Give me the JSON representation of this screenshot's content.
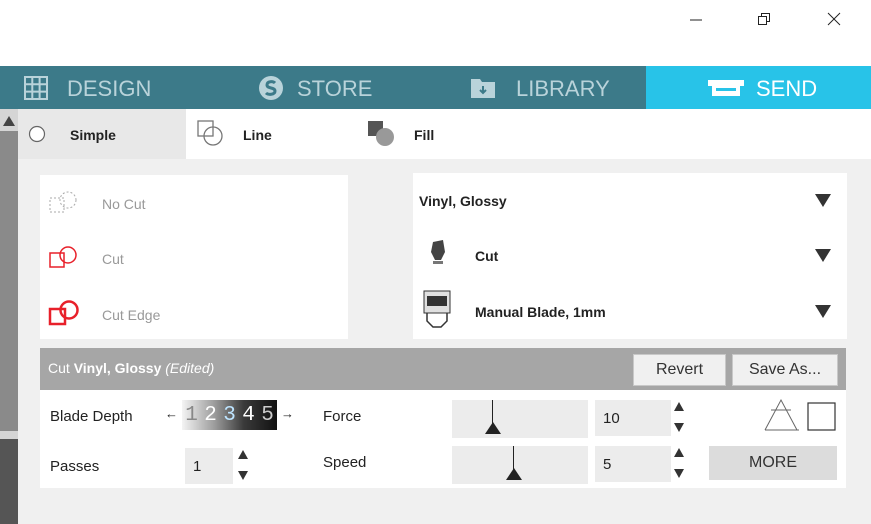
{
  "window": {
    "minimize_icon": "minimize-icon",
    "restore_icon": "restore-icon",
    "close_icon": "close-icon"
  },
  "tabs": [
    {
      "label": "DESIGN",
      "icon": "grid-icon"
    },
    {
      "label": "STORE",
      "icon": "store-s-icon"
    },
    {
      "label": "LIBRARY",
      "icon": "library-folder-icon"
    },
    {
      "label": "SEND",
      "icon": "cutter-icon",
      "active": true
    }
  ],
  "modes": [
    {
      "label": "Simple",
      "icon": "radio-icon"
    },
    {
      "label": "Line",
      "icon": "line-shapes-icon"
    },
    {
      "label": "Fill",
      "icon": "fill-shapes-icon"
    }
  ],
  "cut_options": [
    {
      "label": "No Cut",
      "icon": "no-cut-icon"
    },
    {
      "label": "Cut",
      "icon": "cut-icon"
    },
    {
      "label": "Cut Edge",
      "icon": "cut-edge-icon"
    }
  ],
  "material": {
    "selected": "Vinyl, Glossy",
    "action": "Cut",
    "tool": "Manual Blade, 1mm"
  },
  "settings": {
    "title_prefix": "Cut",
    "title_material": "Vinyl, Glossy",
    "title_status": "(Edited)",
    "revert_label": "Revert",
    "save_as_label": "Save As...",
    "blade_depth_label": "Blade Depth",
    "blade_depth_digits": [
      "1",
      "2",
      "3",
      "4",
      "5"
    ],
    "force_label": "Force",
    "force_value": "10",
    "passes_label": "Passes",
    "passes_value": "1",
    "speed_label": "Speed",
    "speed_value": "5",
    "more_label": "MORE"
  },
  "colors": {
    "tabbar": "#3c7a89",
    "active_tab": "#28c3e8",
    "cut_red": "#e8202a"
  }
}
